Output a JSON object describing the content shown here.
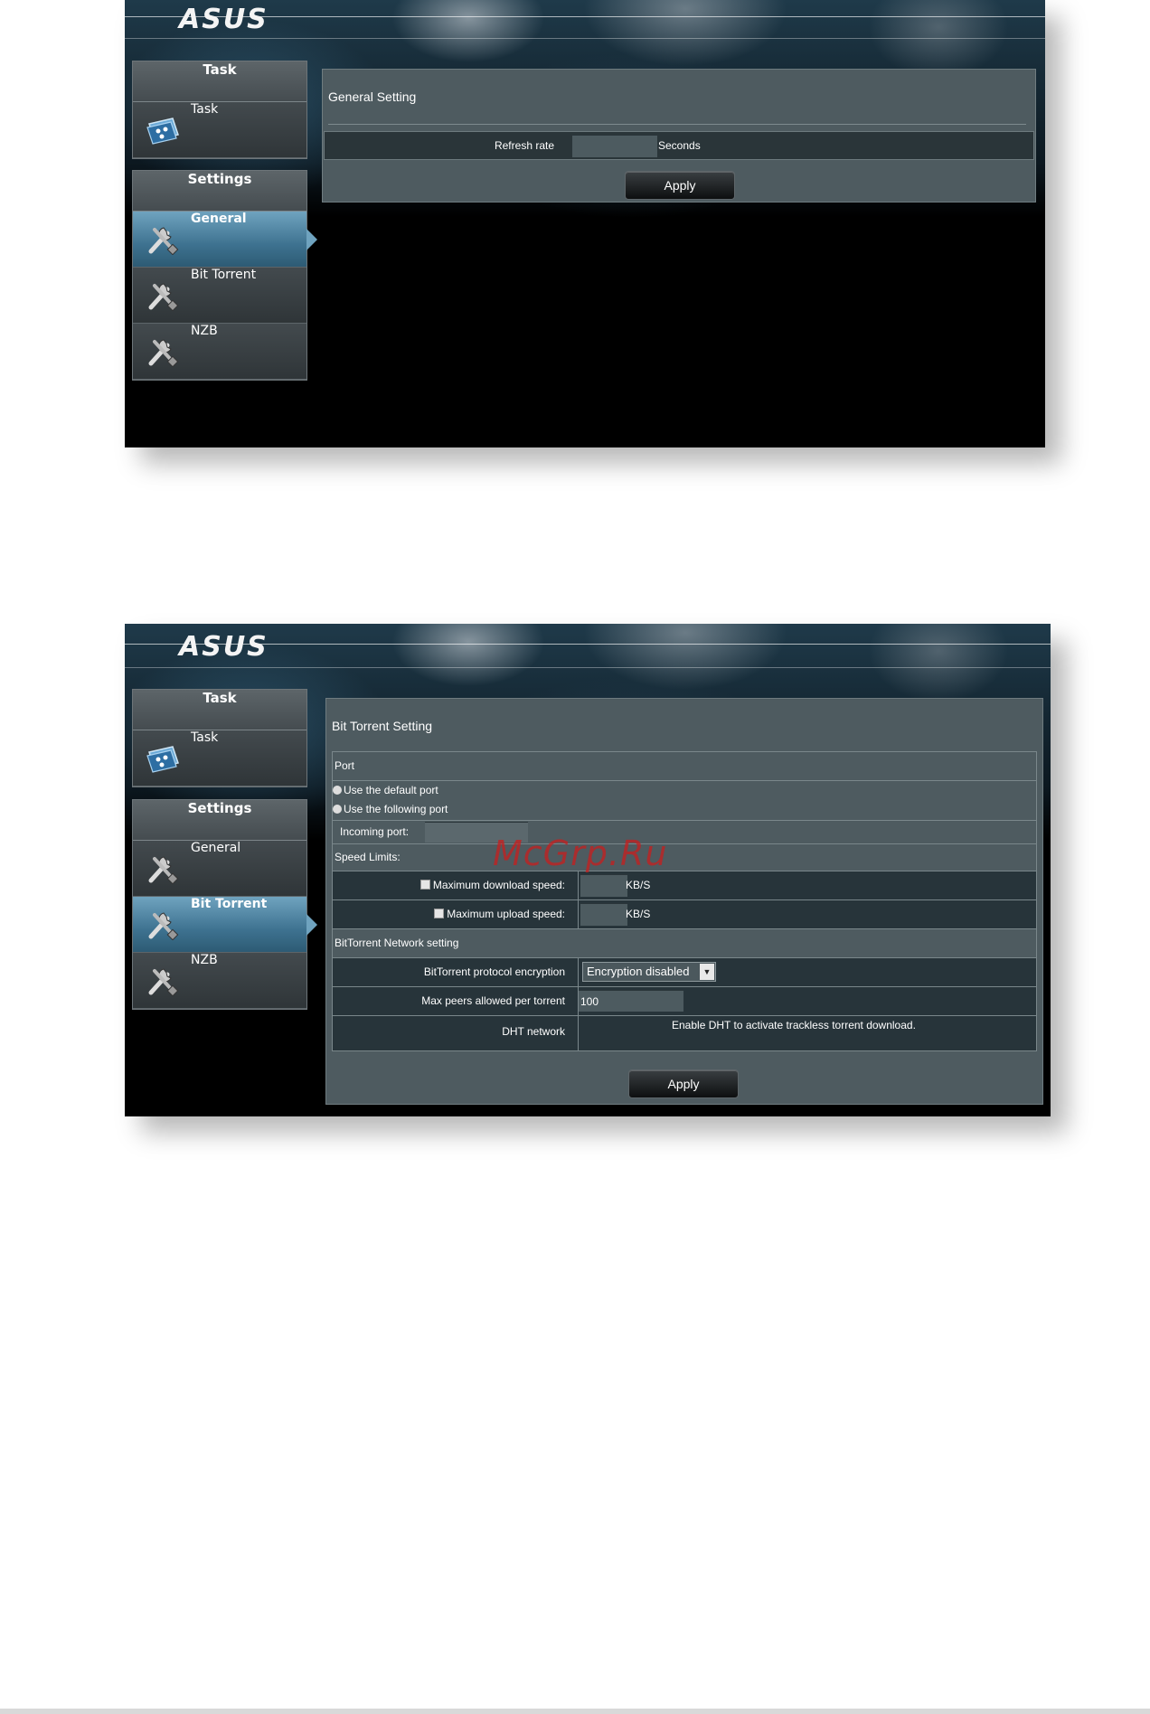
{
  "brand": {
    "logo_text": "ASUS"
  },
  "watermark": "McGrp.Ru",
  "screen1": {
    "menu": {
      "task_header": "Task",
      "task_item": "Task",
      "settings_header": "Settings",
      "items": [
        {
          "label": "General",
          "active": true
        },
        {
          "label": "Bit Torrent",
          "active": false
        },
        {
          "label": "NZB",
          "active": false
        }
      ]
    },
    "panel": {
      "title": "General Setting",
      "refresh_label": "Refresh rate",
      "refresh_value": "",
      "refresh_unit": "Seconds",
      "apply_label": "Apply"
    }
  },
  "screen2": {
    "menu": {
      "task_header": "Task",
      "task_item": "Task",
      "settings_header": "Settings",
      "items": [
        {
          "label": "General",
          "active": false
        },
        {
          "label": "Bit Torrent",
          "active": true
        },
        {
          "label": "NZB",
          "active": false
        }
      ]
    },
    "panel": {
      "title": "Bit Torrent Setting",
      "port_section": "Port",
      "default_port": "Use the default port",
      "following_port": "Use the following port",
      "incoming_port_label": "Incoming port:",
      "incoming_port_value": "",
      "speed_section": "Speed Limits:",
      "max_download_label": "Maximum download speed:",
      "max_download_value": "",
      "max_download_unit": "KB/S",
      "max_upload_label": "Maximum upload speed:",
      "max_upload_value": "",
      "max_upload_unit": "KB/S",
      "network_section": "BitTorrent Network setting",
      "encryption_label": "BitTorrent protocol encryption",
      "encryption_value": "Encryption disabled",
      "max_peers_label": "Max peers allowed per torrent",
      "max_peers_value": "100",
      "dht_label": "DHT network",
      "dht_note": "Enable DHT to activate trackless torrent download.",
      "apply_label": "Apply"
    }
  }
}
